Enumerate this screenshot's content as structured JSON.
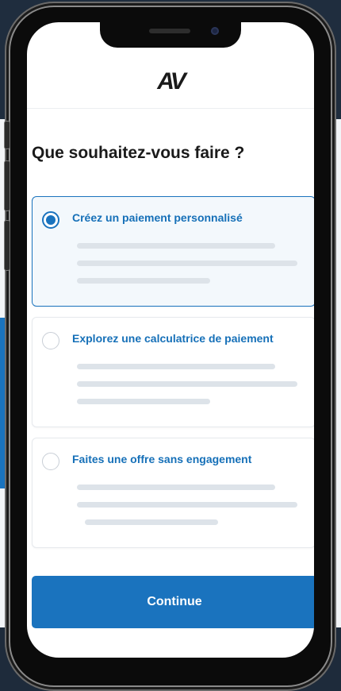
{
  "header": {
    "logo_text": "AV"
  },
  "page_title": "Que souhaitez-vous faire ?",
  "options": [
    {
      "label": "Créez un paiement personnalisé",
      "selected": true
    },
    {
      "label": "Explorez une calculatrice de paiement",
      "selected": false
    },
    {
      "label": "Faites une offre sans engagement",
      "selected": false
    }
  ],
  "continue_label": "Continue",
  "colors": {
    "accent": "#1a73be",
    "label_blue": "#1670b8",
    "placeholder_line": "#dde3e9",
    "title_text": "#1a1a1a"
  }
}
